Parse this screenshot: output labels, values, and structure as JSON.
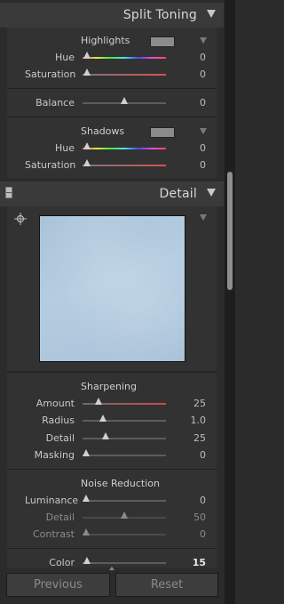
{
  "split_toning": {
    "header_title": "Split Toning",
    "highlights": {
      "title": "Highlights",
      "hue": {
        "label": "Hue",
        "value": "0"
      },
      "saturation": {
        "label": "Saturation",
        "value": "0"
      }
    },
    "balance": {
      "label": "Balance",
      "value": "0"
    },
    "shadows": {
      "title": "Shadows",
      "hue": {
        "label": "Hue",
        "value": "0"
      },
      "saturation": {
        "label": "Saturation",
        "value": "0"
      }
    }
  },
  "detail": {
    "header_title": "Detail",
    "sharpening": {
      "title": "Sharpening",
      "amount": {
        "label": "Amount",
        "value": "25"
      },
      "radius": {
        "label": "Radius",
        "value": "1.0"
      },
      "detail": {
        "label": "Detail",
        "value": "25"
      },
      "masking": {
        "label": "Masking",
        "value": "0"
      }
    },
    "noise_reduction": {
      "title": "Noise Reduction",
      "luminance": {
        "label": "Luminance",
        "value": "0"
      },
      "lum_detail": {
        "label": "Detail",
        "value": "50"
      },
      "contrast": {
        "label": "Contrast",
        "value": "0"
      },
      "color": {
        "label": "Color",
        "value": "15"
      }
    }
  },
  "footer": {
    "previous_label": "Previous",
    "reset_label": "Reset"
  },
  "colors": {
    "panel_bg": "#2b2b2b",
    "section_bg": "#323232",
    "preview_sky": "#a9c3d8"
  }
}
